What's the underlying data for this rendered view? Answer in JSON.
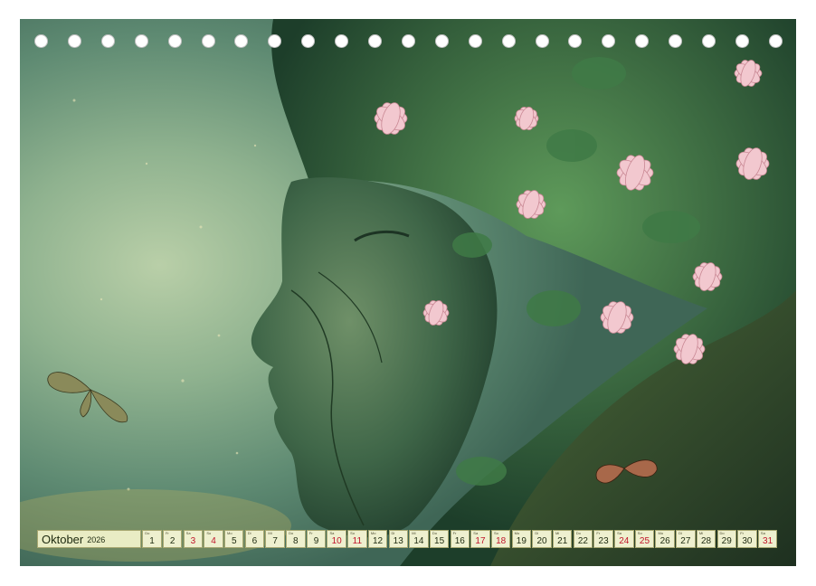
{
  "calendar": {
    "month": "Oktober",
    "year": "2026",
    "weekday_abbrev": [
      "Do",
      "Fr",
      "Sa",
      "So",
      "Mo",
      "Di",
      "Mi"
    ],
    "days": [
      "1",
      "2",
      "3",
      "4",
      "5",
      "6",
      "7",
      "8",
      "9",
      "10",
      "11",
      "12",
      "13",
      "14",
      "15",
      "16",
      "17",
      "18",
      "19",
      "20",
      "21",
      "22",
      "23",
      "24",
      "25",
      "26",
      "27",
      "28",
      "29",
      "30",
      "31"
    ],
    "red_days": [
      "3",
      "4",
      "10",
      "11",
      "17",
      "18",
      "24",
      "25",
      "31"
    ]
  },
  "colors": {
    "background_green": "#5e8a72",
    "label_bg": "#e9ecc4",
    "label_border": "#a8a871",
    "weekend_red": "#c0142a",
    "flower_pink": "#f2c8cf"
  },
  "binding_hole_count": 23
}
